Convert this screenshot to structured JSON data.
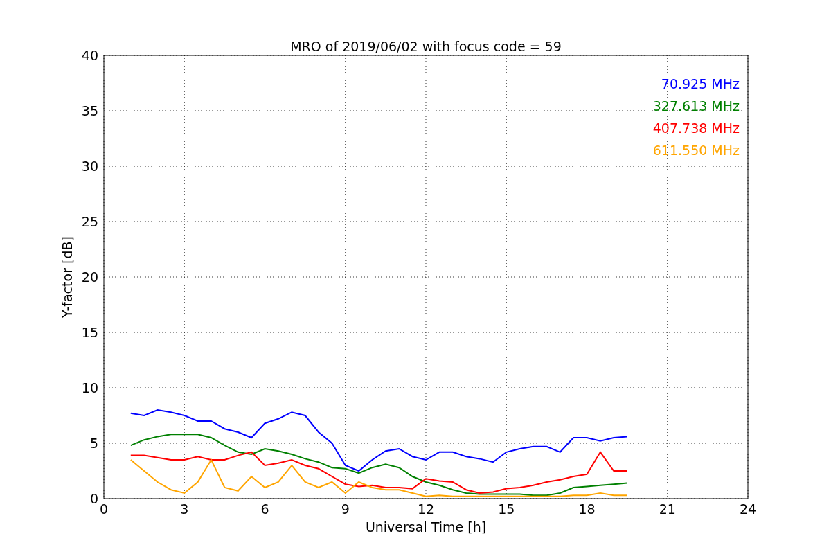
{
  "chart_data": {
    "type": "line",
    "title": "MRO of 2019/06/02 with focus code = 59",
    "xlabel": "Universal Time [h]",
    "ylabel": "Y-factor [dB]",
    "x": [
      1.0,
      1.5,
      2.0,
      2.5,
      3.0,
      3.5,
      4.0,
      4.5,
      5.0,
      5.5,
      6.0,
      6.5,
      7.0,
      7.5,
      8.0,
      8.5,
      9.0,
      9.5,
      10.0,
      10.5,
      11.0,
      11.5,
      12.0,
      12.5,
      13.0,
      13.5,
      14.0,
      14.5,
      15.0,
      15.5,
      16.0,
      16.5,
      17.0,
      17.5,
      18.0,
      18.5,
      19.0,
      19.5
    ],
    "grid": true,
    "xlim": [
      0,
      24
    ],
    "ylim": [
      0,
      40
    ],
    "xticks": [
      0,
      3,
      6,
      9,
      12,
      15,
      18,
      21,
      24
    ],
    "yticks": [
      0,
      5,
      10,
      15,
      20,
      25,
      30,
      35,
      40
    ],
    "series": [
      {
        "name": "70.925 MHz",
        "color": "#0000ff",
        "values": [
          7.7,
          7.5,
          8.0,
          7.8,
          7.5,
          7.0,
          7.0,
          6.3,
          6.0,
          5.5,
          6.8,
          7.2,
          7.8,
          7.5,
          6.0,
          5.0,
          3.0,
          2.5,
          3.5,
          4.3,
          4.5,
          3.8,
          3.5,
          4.2,
          4.2,
          3.8,
          3.6,
          3.3,
          4.2,
          4.5,
          4.7,
          4.7,
          4.2,
          5.5,
          5.5,
          5.2,
          5.5,
          5.6
        ]
      },
      {
        "name": "327.613 MHz",
        "color": "#008000",
        "values": [
          4.8,
          5.3,
          5.6,
          5.8,
          5.8,
          5.8,
          5.5,
          4.8,
          4.2,
          4.0,
          4.5,
          4.3,
          4.0,
          3.6,
          3.3,
          2.8,
          2.7,
          2.3,
          2.8,
          3.1,
          2.8,
          2.0,
          1.5,
          1.2,
          0.8,
          0.5,
          0.4,
          0.4,
          0.4,
          0.4,
          0.3,
          0.3,
          0.5,
          1.0,
          1.1,
          1.2,
          1.3,
          1.4
        ]
      },
      {
        "name": "407.738 MHz",
        "color": "#ff0000",
        "values": [
          3.9,
          3.9,
          3.7,
          3.5,
          3.5,
          3.8,
          3.5,
          3.5,
          3.9,
          4.2,
          3.0,
          3.2,
          3.5,
          3.0,
          2.7,
          2.0,
          1.3,
          1.1,
          1.2,
          1.0,
          1.0,
          0.9,
          1.8,
          1.6,
          1.5,
          0.8,
          0.5,
          0.6,
          0.9,
          1.0,
          1.2,
          1.5,
          1.7,
          2.0,
          2.2,
          4.2,
          2.5,
          2.5
        ]
      },
      {
        "name": "611.550 MHz",
        "color": "#ffa500",
        "values": [
          3.5,
          2.5,
          1.5,
          0.8,
          0.5,
          1.5,
          3.5,
          1.0,
          0.7,
          2.0,
          1.0,
          1.5,
          3.0,
          1.5,
          1.0,
          1.5,
          0.5,
          1.5,
          1.0,
          0.8,
          0.8,
          0.5,
          0.2,
          0.3,
          0.2,
          0.2,
          0.2,
          0.2,
          0.2,
          0.2,
          0.2,
          0.2,
          0.2,
          0.3,
          0.3,
          0.5,
          0.3,
          0.3
        ]
      }
    ]
  }
}
